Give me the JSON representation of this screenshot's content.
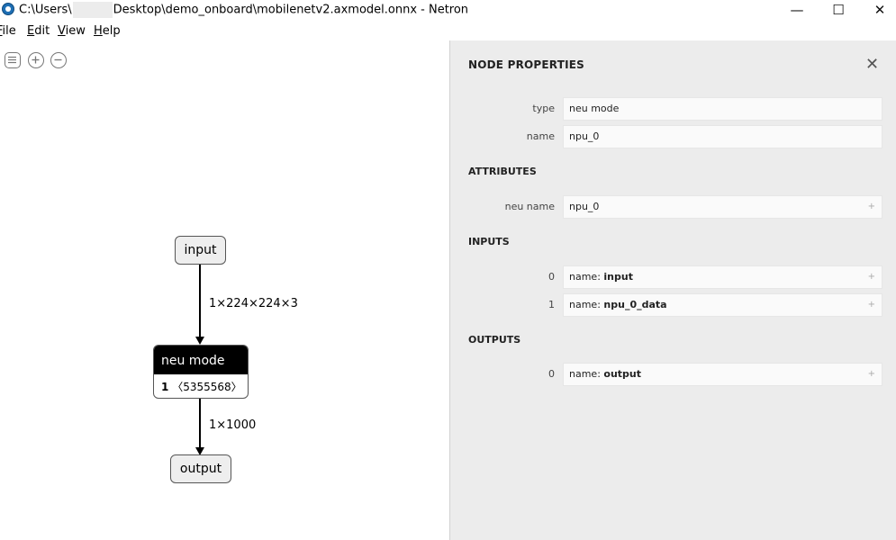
{
  "window": {
    "title_prefix": "C:\\Users\\",
    "title_suffix": "Desktop\\demo_onboard\\mobilenetv2.axmodel.onnx - Netron",
    "minimize_glyph": "—",
    "maximize_glyph": "☐",
    "close_glyph": "✕"
  },
  "menu": {
    "items": [
      "File",
      "Edit",
      "View",
      "Help"
    ],
    "accelerators": [
      "F",
      "E",
      "V",
      "H"
    ]
  },
  "toolbar": {
    "icons": [
      "sidebar-menu-icon",
      "zoom-in-icon",
      "zoom-out-icon"
    ]
  },
  "graph": {
    "input_node": "input",
    "edge_in_label": "1×224×224×3",
    "op_node": {
      "title": "neu mode",
      "index": "1",
      "detail": "〈5355568〉"
    },
    "edge_out_label": "1×1000",
    "output_node": "output"
  },
  "panel": {
    "title": "NODE PROPERTIES",
    "close_glyph": "✕",
    "properties": [
      {
        "label": "type",
        "value": "neu mode"
      },
      {
        "label": "name",
        "value": "npu_0"
      }
    ],
    "attributes_title": "ATTRIBUTES",
    "attributes": [
      {
        "label": "neu name",
        "value": "npu_0"
      }
    ],
    "inputs_title": "INPUTS",
    "inputs": [
      {
        "label": "0",
        "prefix": "name: ",
        "value": "input"
      },
      {
        "label": "1",
        "prefix": "name: ",
        "value": "npu_0_data"
      }
    ],
    "outputs_title": "OUTPUTS",
    "outputs": [
      {
        "label": "0",
        "prefix": "name: ",
        "value": "output"
      }
    ],
    "expand_glyph": "+"
  }
}
